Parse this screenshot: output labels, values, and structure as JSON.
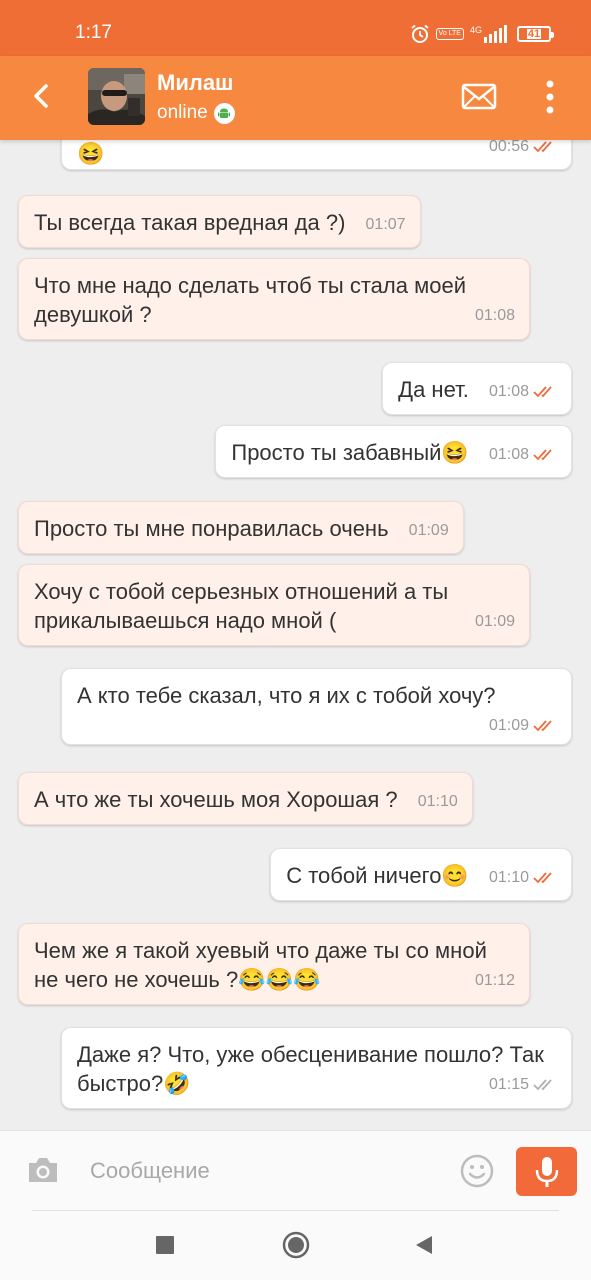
{
  "status_bar": {
    "time": "1:17",
    "network": "4G",
    "volte": "Vo LTE",
    "battery": "41"
  },
  "header": {
    "contact_name": "Милаш",
    "status": "online",
    "back_icon": "chevron-left-icon",
    "mail_icon": "envelope-icon",
    "menu_icon": "more-vertical-icon",
    "colors": {
      "header": "#f7883f",
      "status_bar": "#ee6e35",
      "accent": "#f26a3a"
    }
  },
  "messages": [
    {
      "dir": "out",
      "text": "😆",
      "time": "00:56",
      "status": "read"
    },
    {
      "dir": "in",
      "text": "Ты всегда такая вредная да ?)",
      "time": "01:07"
    },
    {
      "dir": "in",
      "text": "Что мне надо сделать чтоб ты стала моей девушкой ?",
      "time": "01:08"
    },
    {
      "dir": "out",
      "text": "Да нет.",
      "time": "01:08",
      "status": "read"
    },
    {
      "dir": "out",
      "text": "Просто ты забавный😆",
      "time": "01:08",
      "status": "read"
    },
    {
      "dir": "in",
      "text": "Просто ты мне понравилась очень",
      "time": "01:09"
    },
    {
      "dir": "in",
      "text": "Хочу с тобой серьезных отношений а ты прикалываешься надо мной (",
      "time": "01:09"
    },
    {
      "dir": "out",
      "text": "А кто тебе сказал, что я их с тобой хочу?",
      "time": "01:09",
      "status": "read"
    },
    {
      "dir": "in",
      "text": "А что же ты хочешь моя Хорошая ?",
      "time": "01:10"
    },
    {
      "dir": "out",
      "text": "С тобой ничего😊",
      "time": "01:10",
      "status": "read"
    },
    {
      "dir": "in",
      "text": "Чем же я такой хуевый что даже ты со мной не чего не хочешь ?😂😂😂",
      "time": "01:12"
    },
    {
      "dir": "out",
      "text": "Даже я? Что, уже обесценивание пошло? Так быстро?🤣",
      "time": "01:15",
      "status": "delivered"
    }
  ],
  "composer": {
    "placeholder": "Сообщение",
    "camera_icon": "camera-icon",
    "emoji_icon": "smiley-icon",
    "mic_icon": "microphone-icon"
  },
  "nav": {
    "recents_icon": "square-icon",
    "home_icon": "circle-home-icon",
    "back_icon": "triangle-back-icon"
  }
}
